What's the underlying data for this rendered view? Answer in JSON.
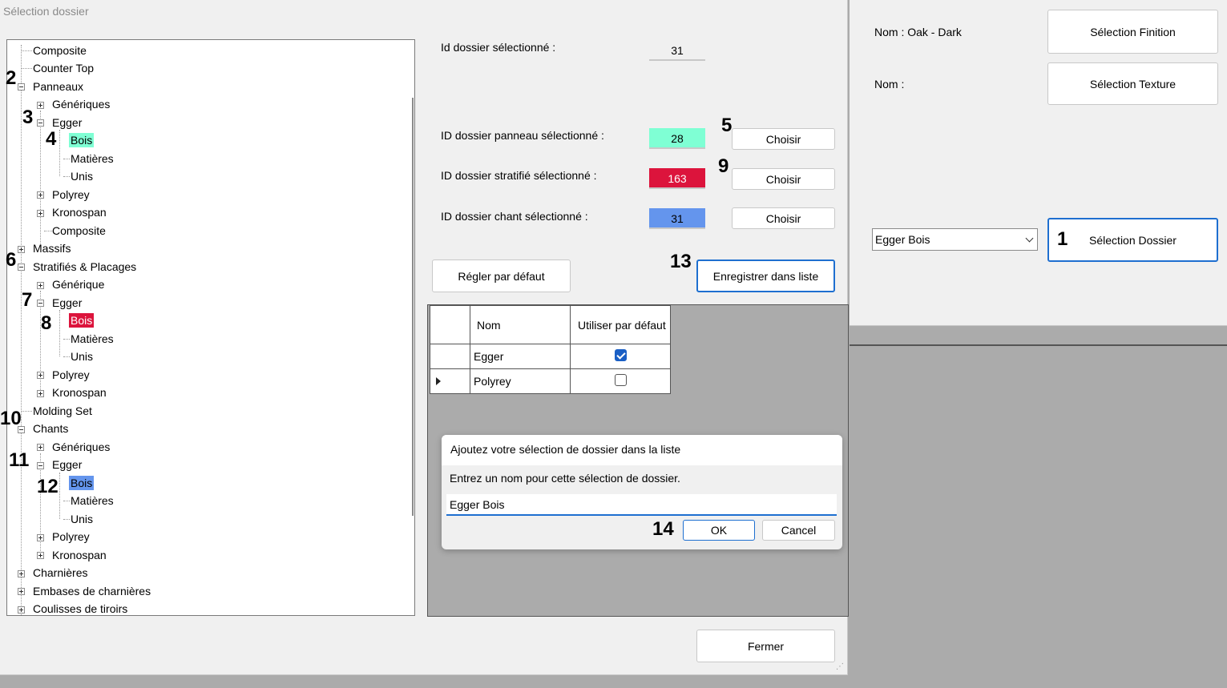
{
  "window": {
    "title": "Sélection dossier"
  },
  "tree": {
    "nodes": [
      {
        "label": "Composite"
      },
      {
        "label": "Counter Top"
      },
      {
        "label": "Panneaux"
      },
      {
        "label": "Génériques"
      },
      {
        "label": "Egger"
      },
      {
        "label": "Bois"
      },
      {
        "label": "Matières"
      },
      {
        "label": "Unis"
      },
      {
        "label": "Polyrey"
      },
      {
        "label": "Kronospan"
      },
      {
        "label": "Composite"
      },
      {
        "label": "Massifs"
      },
      {
        "label": "Stratifiés & Placages"
      },
      {
        "label": "Générique"
      },
      {
        "label": "Egger"
      },
      {
        "label": "Bois"
      },
      {
        "label": "Matières"
      },
      {
        "label": "Unis"
      },
      {
        "label": "Polyrey"
      },
      {
        "label": "Kronospan"
      },
      {
        "label": "Molding Set"
      },
      {
        "label": "Chants"
      },
      {
        "label": "Génériques"
      },
      {
        "label": "Egger"
      },
      {
        "label": "Bois"
      },
      {
        "label": "Matières"
      },
      {
        "label": "Unis"
      },
      {
        "label": "Polyrey"
      },
      {
        "label": "Kronospan"
      },
      {
        "label": "Charnières"
      },
      {
        "label": "Embases de charnières"
      },
      {
        "label": "Coulisses de tiroirs"
      }
    ]
  },
  "annotations": [
    "1",
    "2",
    "3",
    "4",
    "5",
    "6",
    "7",
    "8",
    "9",
    "10",
    "11",
    "12",
    "13",
    "14"
  ],
  "panel": {
    "selected_label": "Id dossier sélectionné :",
    "selected_value": "31",
    "panneau_label": "ID dossier panneau sélectionné :",
    "panneau_value": "28",
    "stratifie_label": "ID dossier stratifié sélectionné :",
    "stratifie_value": "163",
    "chant_label": "ID dossier chant sélectionné :",
    "chant_value": "31",
    "choose_label": "Choisir",
    "default_button": "Régler par défaut",
    "save_button": "Enregistrer dans liste",
    "close_button": "Fermer"
  },
  "colors": {
    "panneau": "#7fffd4",
    "stratifie": "#dc143c",
    "chant": "#6495ed",
    "accent": "#1e6fd0"
  },
  "grid": {
    "headers": [
      "Nom",
      "Utiliser par défaut"
    ],
    "rows": [
      {
        "name": "Egger",
        "default": true
      },
      {
        "name": "Polyrey",
        "default": false
      }
    ]
  },
  "modal": {
    "title": "Ajoutez votre sélection de dossier dans la liste",
    "prompt": "Entrez un nom pour cette sélection de dossier.",
    "input_value": "Egger Bois",
    "ok_button": "OK",
    "cancel_button": "Cancel"
  },
  "side": {
    "finish_name": "Nom : Oak - Dark",
    "texture_name": "Nom :",
    "finish_button": "Sélection Finition",
    "texture_button": "Sélection Texture",
    "folder_select_value": "Egger Bois",
    "folder_button": "Sélection Dossier"
  }
}
